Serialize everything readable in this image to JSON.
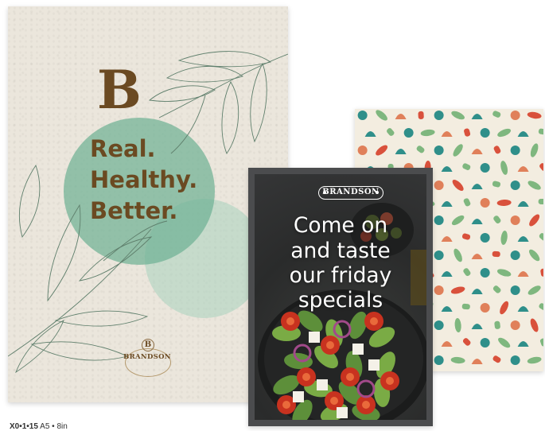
{
  "seed_card": {
    "monogram": "B",
    "tagline": [
      "Real.",
      "Healthy.",
      "Better."
    ],
    "logo_letter": "B",
    "logo_name": "BRANDSON",
    "colors": {
      "paper": "#ebe6dc",
      "brown": "#6b4a22",
      "mint": "#6fb294",
      "leaf_line": "#5f7f6c"
    }
  },
  "menu_card": {
    "brand_label": "BRANDSON",
    "headline": [
      "Come on",
      "and taste",
      "our friday",
      "specials"
    ],
    "colors": {
      "background": "#2a2b2b",
      "text": "#ffffff"
    }
  },
  "pattern_card": {
    "colors": {
      "background": "#f3ede0",
      "teal": "#2f8f8a",
      "green": "#7fb77f",
      "orange": "#e0805a",
      "red": "#d9513c"
    }
  },
  "caption": {
    "code": "X0•1•15",
    "text": "A5 • 8in"
  },
  "icons": [
    "leaf-icon",
    "salad-bowl-icon",
    "vegetable-pattern-icon",
    "brand-logo-icon"
  ]
}
